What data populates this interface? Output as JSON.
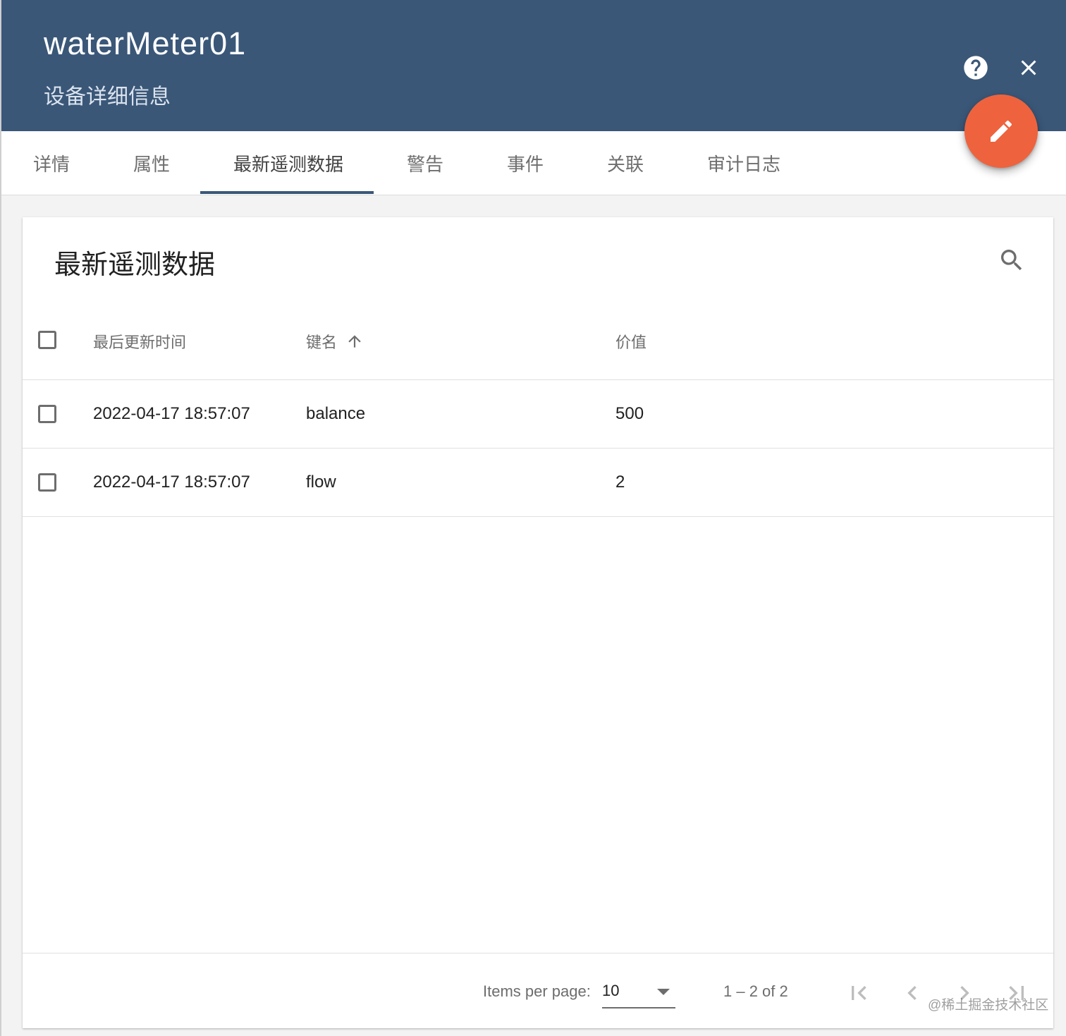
{
  "header": {
    "title": "waterMeter01",
    "subtitle": "设备详细信息",
    "help_icon": "help-circle-icon",
    "close_icon": "close-icon",
    "edit_icon": "pencil-icon",
    "background_color": "#3a5778",
    "fab_color": "#ee633d"
  },
  "tabs": [
    {
      "label": "详情"
    },
    {
      "label": "属性"
    },
    {
      "label": "最新遥测数据",
      "active": true
    },
    {
      "label": "警告"
    },
    {
      "label": "事件"
    },
    {
      "label": "关联"
    },
    {
      "label": "审计日志"
    }
  ],
  "card": {
    "title": "最新遥测数据",
    "search_icon": "search-icon"
  },
  "table": {
    "columns": [
      {
        "label": "最后更新时间"
      },
      {
        "label": "键名",
        "sort": "ascending",
        "sort_icon": "arrow-up-icon"
      },
      {
        "label": "价值"
      }
    ],
    "rows": [
      {
        "time": "2022-04-17 18:57:07",
        "key": "balance",
        "value": "500"
      },
      {
        "time": "2022-04-17 18:57:07",
        "key": "flow",
        "value": "2"
      }
    ]
  },
  "paginator": {
    "items_per_page_label": "Items per page:",
    "page_size": "10",
    "range_label": "1 – 2 of 2"
  },
  "watermark": "@稀土掘金技术社区"
}
